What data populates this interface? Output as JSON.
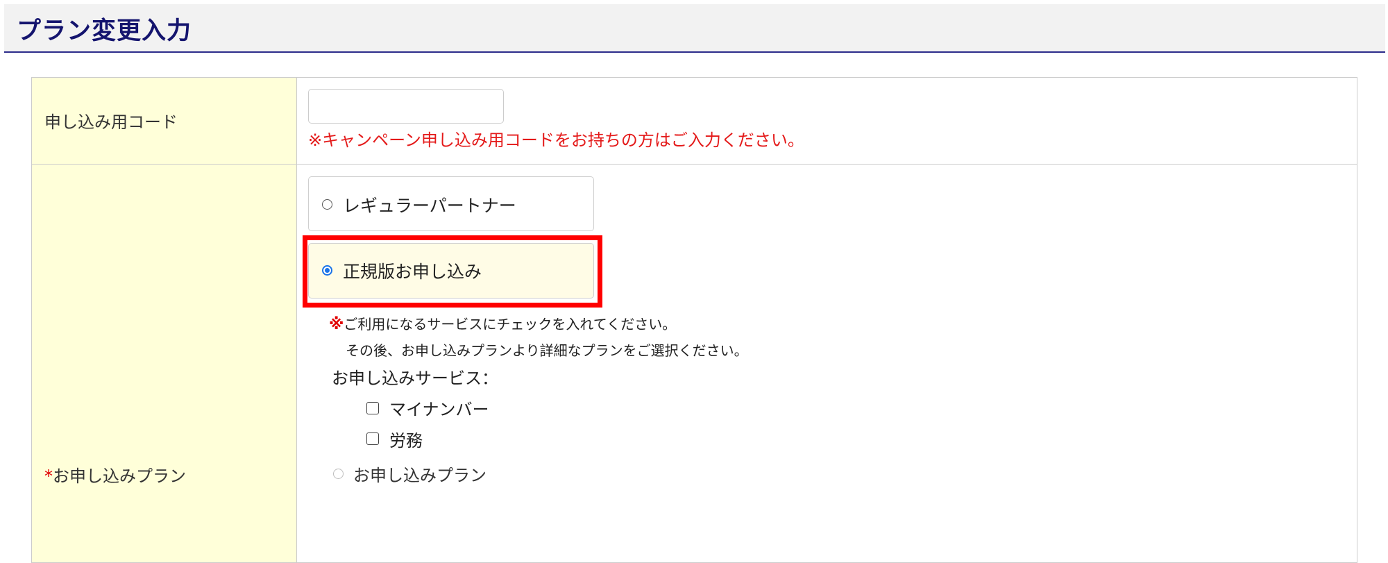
{
  "header": {
    "title": "プラン変更入力"
  },
  "form": {
    "code_row": {
      "label": "申し込み用コード",
      "input_value": "",
      "note": "※キャンペーン申し込み用コードをお持ちの方はご入力ください。"
    },
    "plan_row": {
      "required_mark": "*",
      "label": "お申し込みプラン",
      "options": [
        {
          "label": "レギュラーパートナー",
          "selected": false
        },
        {
          "label": "正規版お申し込み",
          "selected": true
        }
      ],
      "note_mark": "※",
      "note_line1": "ご利用になるサービスにチェックを入れてください。",
      "note_line2": "その後、お申し込みプランより詳細なプランをご選択ください。",
      "services_label": "お申し込みサービス：",
      "services": [
        {
          "label": "マイナンバー",
          "checked": false
        },
        {
          "label": "労務",
          "checked": false
        }
      ],
      "subplan_label": "お申し込みプラン",
      "subplan_disabled": true
    }
  },
  "colors": {
    "title": "#14146e",
    "label_bg": "#ffffd9",
    "note_red": "#e41a1a",
    "highlight": "#ff0000",
    "radio_selected": "#1a73e8"
  }
}
